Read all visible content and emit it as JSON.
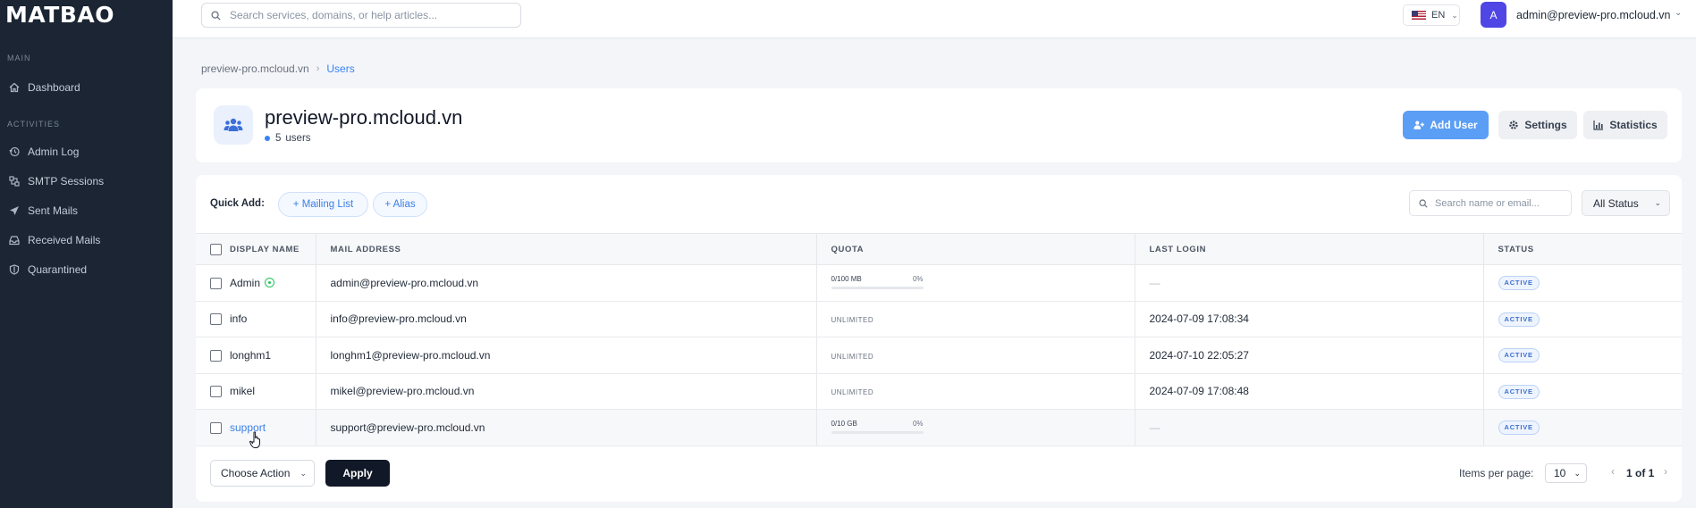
{
  "brand": "MATBAO",
  "sidebar": {
    "sections": [
      {
        "title": "MAIN",
        "items": [
          {
            "label": "Dashboard",
            "icon": "home-icon"
          }
        ]
      },
      {
        "title": "ACTIVITIES",
        "items": [
          {
            "label": "Admin Log",
            "icon": "history-icon"
          },
          {
            "label": "SMTP Sessions",
            "icon": "sessions-icon"
          },
          {
            "label": "Sent Mails",
            "icon": "paper-plane-icon"
          },
          {
            "label": "Received Mails",
            "icon": "inbox-icon"
          },
          {
            "label": "Quarantined",
            "icon": "shield-icon"
          }
        ]
      }
    ]
  },
  "topbar": {
    "search_placeholder": "Search services, domains, or help articles...",
    "language": "EN",
    "avatar_initial": "A",
    "user_email": "admin@preview-pro.mcloud.vn"
  },
  "breadcrumb": {
    "root": "preview-pro.mcloud.vn",
    "current": "Users"
  },
  "header": {
    "title": "preview-pro.mcloud.vn",
    "user_count": "5",
    "user_count_label": "users",
    "add_user": "Add User",
    "settings": "Settings",
    "statistics": "Statistics"
  },
  "toolbar": {
    "quick_add_label": "Quick Add:",
    "mailing_list": "+ Mailing List",
    "alias": "+ Alias",
    "search_placeholder": "Search name or email...",
    "status_filter": "All Status"
  },
  "table": {
    "columns": [
      "DISPLAY NAME",
      "MAIL ADDRESS",
      "QUOTA",
      "LAST LOGIN",
      "STATUS"
    ],
    "rows": [
      {
        "name": "Admin",
        "email": "admin@preview-pro.mcloud.vn",
        "quota_text": "0/100 MB",
        "quota_pct": "0%",
        "last_login": "—",
        "status": "ACTIVE"
      },
      {
        "name": "info",
        "email": "info@preview-pro.mcloud.vn",
        "quota_text": "UNLIMITED",
        "quota_pct": "",
        "last_login": "2024-07-09 17:08:34",
        "status": "ACTIVE"
      },
      {
        "name": "longhm1",
        "email": "longhm1@preview-pro.mcloud.vn",
        "quota_text": "UNLIMITED",
        "quota_pct": "",
        "last_login": "2024-07-10 22:05:27",
        "status": "ACTIVE"
      },
      {
        "name": "mikel",
        "email": "mikel@preview-pro.mcloud.vn",
        "quota_text": "UNLIMITED",
        "quota_pct": "",
        "last_login": "2024-07-09 17:08:48",
        "status": "ACTIVE"
      },
      {
        "name": "support",
        "email": "support@preview-pro.mcloud.vn",
        "quota_text": "0/10 GB",
        "quota_pct": "0%",
        "last_login": "—",
        "status": "ACTIVE"
      }
    ]
  },
  "footer": {
    "choose_action": "Choose Action",
    "apply": "Apply",
    "items_per_page_label": "Items per page:",
    "items_per_page": "10",
    "page_info": "1 of 1"
  },
  "colors": {
    "sidebar_bg": "#1b2533",
    "accent": "#5b9ef5",
    "link": "#3b7fe6",
    "active_badge": "#3b6fcf"
  }
}
